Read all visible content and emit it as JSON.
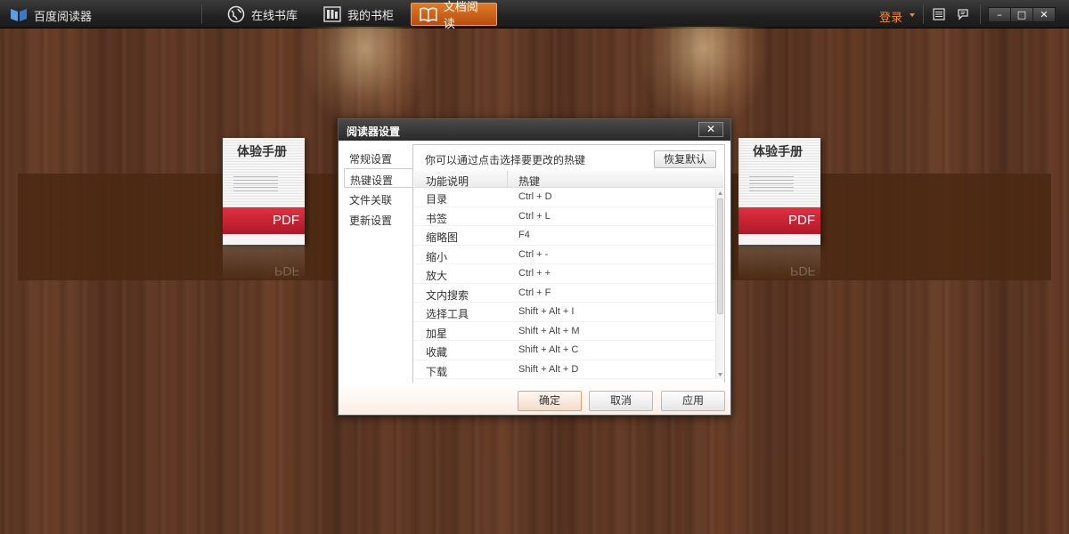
{
  "app": {
    "title": "百度阅读器"
  },
  "nav": [
    {
      "label": "在线书库",
      "icon": "globe-icon"
    },
    {
      "label": "我的书柜",
      "icon": "bookshelf-icon"
    },
    {
      "label": "文档阅读",
      "icon": "open-book-icon",
      "active": true
    }
  ],
  "topbar": {
    "login_label": "登录",
    "window_buttons": {
      "minimize": "–",
      "maximize": "□",
      "close": "✕"
    }
  },
  "books": [
    {
      "title": "体验手册",
      "badge": "PDF"
    },
    {
      "title": "体验手册",
      "badge": "PDF"
    }
  ],
  "dialog": {
    "title": "阅读器设置",
    "close_label": "✕",
    "sidebar": [
      {
        "label": "常规设置"
      },
      {
        "label": "热键设置",
        "selected": true
      },
      {
        "label": "文件关联"
      },
      {
        "label": "更新设置"
      }
    ],
    "hint": "你可以通过点击选择要更改的热键",
    "restore_label": "恢复默认",
    "columns": [
      "功能说明",
      "热键"
    ],
    "hotkeys": [
      {
        "func": "目录",
        "key": "Ctrl + D"
      },
      {
        "func": "书签",
        "key": "Ctrl + L"
      },
      {
        "func": "缩略图",
        "key": "F4"
      },
      {
        "func": "缩小",
        "key": "Ctrl + -"
      },
      {
        "func": "放大",
        "key": "Ctrl + +"
      },
      {
        "func": "文内搜索",
        "key": "Ctrl + F"
      },
      {
        "func": "选择工具",
        "key": "Shift + Alt + I"
      },
      {
        "func": "加星",
        "key": "Shift + Alt + M"
      },
      {
        "func": "收藏",
        "key": "Shift + Alt + C"
      },
      {
        "func": "下载",
        "key": "Shift + Alt + D"
      }
    ],
    "buttons": {
      "ok": "确定",
      "cancel": "取消",
      "apply": "应用"
    }
  },
  "colors": {
    "accent": "#e0701f",
    "login": "#ff8a1f",
    "pdf_red": "#d02838"
  }
}
